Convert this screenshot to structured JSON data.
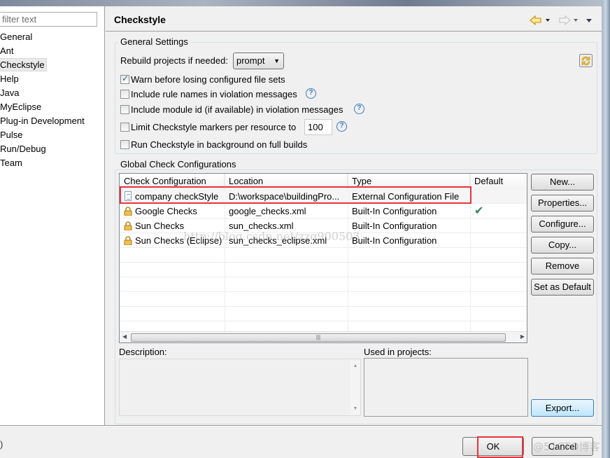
{
  "sidebar": {
    "filter_placeholder": "filter text",
    "items": [
      {
        "label": "General"
      },
      {
        "label": "Ant"
      },
      {
        "label": "Checkstyle",
        "selected": true
      },
      {
        "label": "Help"
      },
      {
        "label": "Java"
      },
      {
        "label": "MyEclipse"
      },
      {
        "label": "Plug-in Development"
      },
      {
        "label": "Pulse"
      },
      {
        "label": "Run/Debug"
      },
      {
        "label": "Team"
      }
    ]
  },
  "page": {
    "title": "Checkstyle",
    "nav_icons": [
      "back-arrow-icon",
      "forward-arrow-icon",
      "view-menu-icon"
    ]
  },
  "general": {
    "title": "General Settings",
    "rebuild_label": "Rebuild projects if needed:",
    "rebuild_value": "prompt",
    "options": [
      {
        "label": "Warn before losing configured file sets",
        "checked": true,
        "help": false
      },
      {
        "label": "Include rule names in violation messages",
        "checked": false,
        "help": true
      },
      {
        "label": "Include module id (if available) in violation messages",
        "checked": false,
        "help": true
      },
      {
        "label": "Limit Checkstyle markers per resource to",
        "checked": false,
        "help": true,
        "value": "100"
      },
      {
        "label": "Run Checkstyle in background on full builds",
        "checked": false,
        "help": false
      }
    ]
  },
  "global": {
    "title": "Global Check Configurations",
    "columns": [
      "Check Configuration",
      "Location",
      "Type",
      "Default"
    ],
    "rows": [
      {
        "name": "company checkStyle",
        "location": "D:\\workspace\\buildingPro...",
        "type": "External Configuration File",
        "default": false,
        "icon": "document-icon"
      },
      {
        "name": "Google Checks",
        "location": "google_checks.xml",
        "type": "Built-In Configuration",
        "default": true,
        "icon": "lock-icon"
      },
      {
        "name": "Sun Checks",
        "location": "sun_checks.xml",
        "type": "Built-In Configuration",
        "default": false,
        "icon": "lock-icon"
      },
      {
        "name": "Sun Checks (Eclipse)",
        "location": "sun_checks_eclipse.xml",
        "type": "Built-In Configuration",
        "default": false,
        "icon": "lock-icon"
      }
    ],
    "buttons": [
      "New...",
      "Properties...",
      "Configure...",
      "Copy...",
      "Remove",
      "Set as Default"
    ],
    "description_label": "Description:",
    "used_label": "Used in projects:",
    "export_label": "Export..."
  },
  "footer": {
    "ok": "OK",
    "cancel": "Cancel"
  },
  "watermarks": [
    "http://blog.csdn.net/zzq900503",
    "@51CTO博客"
  ],
  "colors": {
    "highlight": "#e8343a",
    "check": "#2e8b57",
    "help": "#3a78c3"
  }
}
